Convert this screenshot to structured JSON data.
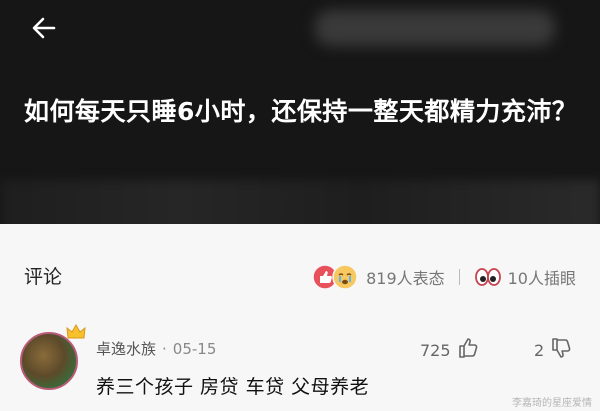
{
  "question": {
    "title": "如何每天只睡6小时，还保持一整天都精力充沛？"
  },
  "comments_header": {
    "title": "评论",
    "reactions_count": "819人表态",
    "bookmarks_count": "10人插眼"
  },
  "comment": {
    "username": "卓逸水族",
    "date": "05-15",
    "text": "养三个孩子  房贷  车贷   父母养老",
    "likes": "725",
    "dislikes": "2"
  },
  "watermark": "李嘉琦的星座爱情"
}
